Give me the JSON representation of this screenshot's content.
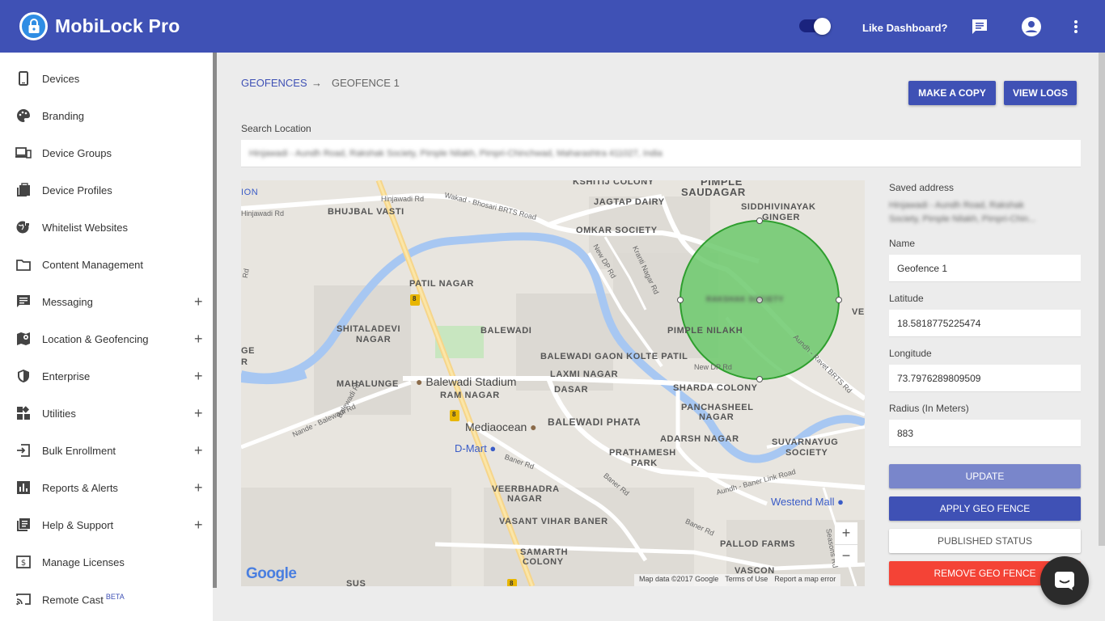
{
  "header": {
    "app_title": "MobiLock Pro",
    "like_dashboard": "Like Dashboard?"
  },
  "sidebar": {
    "items": [
      {
        "label": "Devices",
        "icon": "phone-icon",
        "expandable": false
      },
      {
        "label": "Branding",
        "icon": "palette-icon",
        "expandable": false
      },
      {
        "label": "Device Groups",
        "icon": "devices-icon",
        "expandable": false
      },
      {
        "label": "Device Profiles",
        "icon": "profiles-icon",
        "expandable": false
      },
      {
        "label": "Whitelist Websites",
        "icon": "globe-lock-icon",
        "expandable": false
      },
      {
        "label": "Content Management",
        "icon": "folder-icon",
        "expandable": false
      },
      {
        "label": "Messaging",
        "icon": "message-icon",
        "expandable": true
      },
      {
        "label": "Location & Geofencing",
        "icon": "map-pin-icon",
        "expandable": true
      },
      {
        "label": "Enterprise",
        "icon": "shield-icon",
        "expandable": true
      },
      {
        "label": "Utilities",
        "icon": "widgets-icon",
        "expandable": true
      },
      {
        "label": "Bulk Enrollment",
        "icon": "login-icon",
        "expandable": true
      },
      {
        "label": "Reports & Alerts",
        "icon": "chart-icon",
        "expandable": true
      },
      {
        "label": "Help & Support",
        "icon": "help-doc-icon",
        "expandable": true
      },
      {
        "label": "Manage Licenses",
        "icon": "license-icon",
        "expandable": false
      },
      {
        "label": "Remote Cast",
        "icon": "cast-icon",
        "expandable": false,
        "badge": "BETA"
      }
    ],
    "plus": "+"
  },
  "breadcrumb": {
    "root": "GEOFENCES",
    "arrow": "→",
    "current": "GEOFENCE 1"
  },
  "actions": {
    "make_copy": "MAKE A COPY",
    "view_logs": "VIEW LOGS"
  },
  "search": {
    "label": "Search Location",
    "value": "Hinjawadi - Aundh Road, Rakshak Society, Pimple Nilakh, Pimpri-Chinchwad, Maharashtra 411027, India"
  },
  "form": {
    "saved_address_label": "Saved address",
    "saved_address_line1": "Hinjawadi - Aundh Road, Rakshak",
    "saved_address_line2": "Society, Pimple Nilakh, Pimpri-Chin...",
    "name_label": "Name",
    "name_value": "Geofence 1",
    "latitude_label": "Latitude",
    "latitude_value": "18.5818775225474",
    "longitude_label": "Longitude",
    "longitude_value": "73.7976289809509",
    "radius_label": "Radius (In Meters)",
    "radius_value": "883"
  },
  "buttons": {
    "update": "UPDATE",
    "apply": "APPLY GEO FENCE",
    "published": "PUBLISHED STATUS",
    "remove": "REMOVE GEO FENCE"
  },
  "map": {
    "labels": {
      "kshitij": "KSHITIJ COLONY",
      "pimple_saudagar1": "PIMPLE",
      "pimple_saudagar2": "SAUDAGAR",
      "ion": "ION",
      "bhujbal": "BHUJBAL VASTI",
      "jagtap": "JAGTAP DAIRY",
      "siddhivinayak1": "SIDDHIVINAYAK",
      "siddhivinayak2": "GINGER",
      "omkar": "OMKAR SOCIETY",
      "patil_nagar": "PATIL NAGAR",
      "shitaladevi1": "SHITALADEVI",
      "shitaladevi2": "NAGAR",
      "balewadi": "BALEWADI",
      "pimple_nilakh": "PIMPLE NILAKH",
      "rakshak": "RAKSHAK SOCIETY",
      "balewadi_gaon": "BALEWADI GAON KOLTE PATIL",
      "laxmi": "LAXMI NAGAR",
      "mahalunge": "MAHALUNGE",
      "stadium": "Balewadi Stadium",
      "ram_nagar": "RAM NAGAR",
      "dasar": "DASAR",
      "sharda": "SHARDA COLONY",
      "panchasheel1": "PANCHASHEEL",
      "panchasheel2": "NAGAR",
      "mediaocean": "Mediaocean",
      "balewadi_phata": "BALEWADI PHATA",
      "dmart": "D-Mart",
      "adarsh": "ADARSH NAGAR",
      "suvarnayug1": "SUVARNAYUG",
      "suvarnayug2": "SOCIETY",
      "prathamesh1": "PRATHAMESH",
      "prathamesh2": "PARK",
      "veerbhadra1": "VEERBHADRA",
      "veerbhadra2": "NAGAR",
      "westend": "Westend Mall",
      "vasant": "VASANT VIHAR BANER",
      "pallod": "PALLOD FARMS",
      "samarth1": "SAMARTH",
      "samarth2": "COLONY",
      "vascon": "VASCON",
      "sus": "SUS",
      "ge1": "GE",
      "ge2": "R",
      "ve": "VE",
      "hinjawadi_rd": "Hinjawadi Rd",
      "hinjawadi_rd2": "Hinjawadi Rd",
      "wakad": "Wakad - Bhosari BRTS Road",
      "new_dp": "New DP Rd",
      "kranti": "Kranti Nagar Rd",
      "new_dp2": "New DP Rd",
      "aundh": "Aundh - Ravet BRTS Rd",
      "nande": "Nande - Balewadi Rd",
      "baner": "Baner Rd",
      "baner2": "Baner Rd",
      "baner3": "Baner Rd",
      "aundh_baner": "Aundh - Baner Link Road",
      "seasons": "Seasons Rd",
      "balewadi_rd": "Balewadi Rd",
      "rd": "Rd",
      "highway": "8"
    },
    "zoom_in": "+",
    "zoom_out": "−",
    "google": "Google",
    "attribution": "Map data ©2017 Google",
    "terms": "Terms of Use",
    "report": "Report a map error"
  },
  "colors": {
    "primary": "#3f51b5",
    "update_disabled": "#7986cb",
    "remove": "#f44336",
    "geofence_fill": "#6cc96c",
    "geofence_stroke": "#2e9e2e"
  }
}
